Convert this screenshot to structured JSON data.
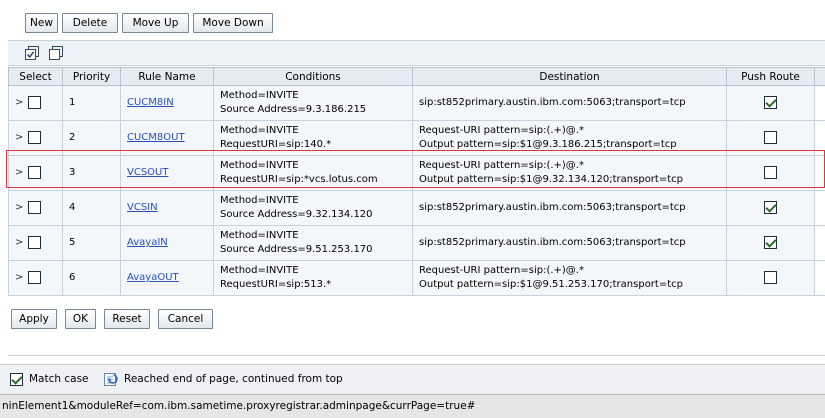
{
  "toolbar": {
    "new_label": "New",
    "delete_label": "Delete",
    "move_up_label": "Move Up",
    "move_down_label": "Move Down"
  },
  "icon_bar": {
    "icons": [
      "select-all-icon",
      "deselect-all-icon"
    ]
  },
  "table": {
    "headers": {
      "select": "Select",
      "priority": "Priority",
      "rule_name": "Rule Name",
      "conditions": "Conditions",
      "destination": "Destination",
      "push_route": "Push Route"
    },
    "expand_glyph": ">",
    "rows": [
      {
        "priority": "1",
        "rule_name": "CUCM8IN",
        "conditions": [
          "Method=INVITE",
          "Source Address=9.3.186.215"
        ],
        "destination": [
          "sip:st852primary.austin.ibm.com:5063;transport=tcp"
        ],
        "push_route": true
      },
      {
        "priority": "2",
        "rule_name": "CUCM8OUT",
        "conditions": [
          "Method=INVITE",
          "RequestURI=sip:140.*"
        ],
        "destination": [
          "Request-URI pattern=sip:(.+)@.*",
          "Output pattern=sip:$1@9.3.186.215;transport=tcp"
        ],
        "push_route": false
      },
      {
        "priority": "3",
        "rule_name": "VCSOUT",
        "conditions": [
          "Method=INVITE",
          "RequestURI=sip:*vcs.lotus.com"
        ],
        "destination": [
          "Request-URI pattern=sip:(.+)@.*",
          "Output pattern=sip:$1@9.32.134.120;transport=tcp"
        ],
        "push_route": false
      },
      {
        "priority": "4",
        "rule_name": "VCSIN",
        "conditions": [
          "Method=INVITE",
          "Source Address=9.32.134.120"
        ],
        "destination": [
          "sip:st852primary.austin.ibm.com:5063;transport=tcp"
        ],
        "push_route": true
      },
      {
        "priority": "5",
        "rule_name": "AvayaIN",
        "conditions": [
          "Method=INVITE",
          "Source Address=9.51.253.170"
        ],
        "destination": [
          "sip:st852primary.austin.ibm.com:5063;transport=tcp"
        ],
        "push_route": true
      },
      {
        "priority": "6",
        "rule_name": "AvayaOUT",
        "conditions": [
          "Method=INVITE",
          "RequestURI=sip:513.*"
        ],
        "destination": [
          "Request-URI pattern=sip:(.+)@.*",
          "Output pattern=sip:$1@9.51.253.170;transport=tcp"
        ],
        "push_route": false
      }
    ]
  },
  "bottom_buttons": {
    "apply_label": "Apply",
    "ok_label": "OK",
    "reset_label": "Reset",
    "cancel_label": "Cancel"
  },
  "find_bar": {
    "match_case_label": "Match case",
    "match_case_checked": true,
    "message": "Reached end of page, continued from top"
  },
  "status_bar": {
    "text": "ninElement1&moduleRef=com.ibm.sametime.proxyregistrar.adminpage&currPage=true#"
  },
  "colors": {
    "link": "#2b4fb8",
    "highlight_border": "#d9363e",
    "header_bg": "#e4ebf2"
  }
}
